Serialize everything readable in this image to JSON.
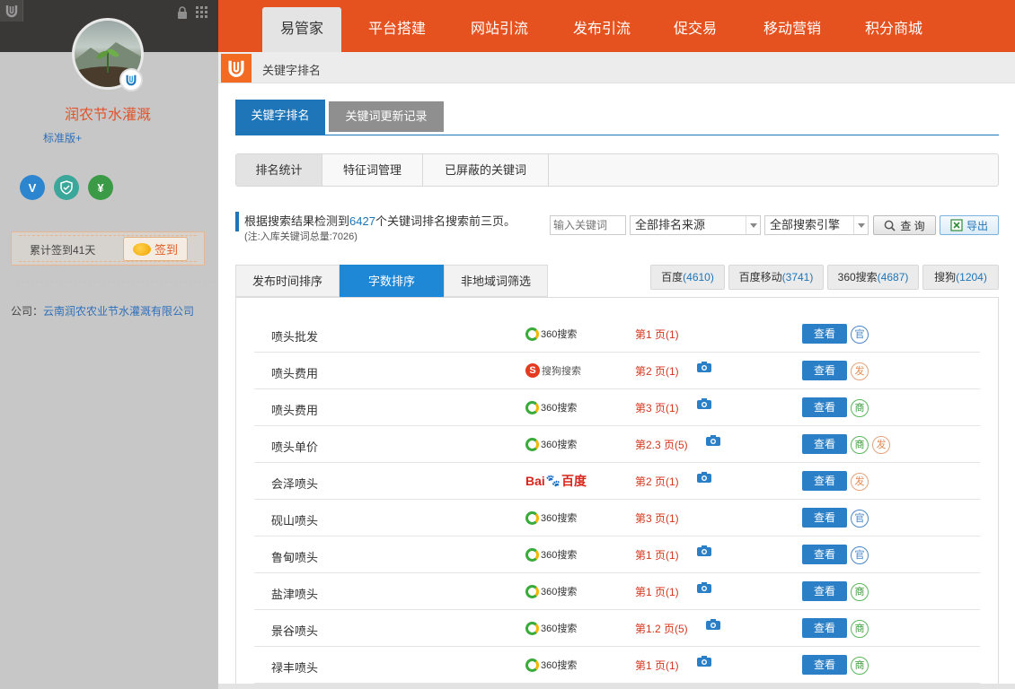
{
  "sidebar": {
    "company_short": "润农节水灌溉",
    "edition": "标准版+",
    "signin_text": "累计签到41天",
    "signin_button": "签到",
    "company_label": "公司：",
    "company_full": "云南润农农业节水灌溉有限公司",
    "badges": [
      "V",
      "✓",
      "¥"
    ]
  },
  "topnav": {
    "tabs": [
      "易管家",
      "平台搭建",
      "网站引流",
      "发布引流",
      "促交易",
      "移动营销",
      "积分商城"
    ],
    "active": 0
  },
  "breadcrumb": {
    "title": "关键字排名"
  },
  "main_tabs": [
    "关键字排名",
    "关键词更新记录"
  ],
  "sub_tabs": [
    "排名统计",
    "特征词管理",
    "已屏蔽的关键词"
  ],
  "info": {
    "prefix": "根据搜索结果检测到",
    "count": "6427",
    "suffix": "个关键词排名搜索前三页。",
    "note": "(注:入库关键词总量:7026)"
  },
  "filters": {
    "keyword_placeholder": "输入关键词",
    "source_select": "全部排名来源",
    "engine_select": "全部搜索引擎",
    "query_button": "查 询",
    "export_button": "导出"
  },
  "sort_tabs": [
    "发布时间排序",
    "字数排序",
    "非地域词筛选"
  ],
  "engines": [
    {
      "name": "百度",
      "count": "(4610)"
    },
    {
      "name": "百度移动",
      "count": "(3741)"
    },
    {
      "name": "360搜索",
      "count": "(4687)"
    },
    {
      "name": "搜狗",
      "count": "(1204)"
    }
  ],
  "engine_labels": {
    "e360": "360搜索",
    "sogou": "搜狗搜索",
    "baidu_a": "Bai",
    "baidu_b": "百度",
    "sogou_s": "S"
  },
  "view_label": "查看",
  "rows": [
    {
      "keyword": "喷头批发",
      "engine": "360",
      "rank": "第1 页(1)",
      "camera": false,
      "tags": [
        "官"
      ]
    },
    {
      "keyword": "喷头费用",
      "engine": "sogou",
      "rank": "第2 页(1)",
      "camera": true,
      "tags": [
        "发"
      ]
    },
    {
      "keyword": "喷头费用",
      "engine": "360",
      "rank": "第3 页(1)",
      "camera": true,
      "tags": [
        "商"
      ]
    },
    {
      "keyword": "喷头单价",
      "engine": "360",
      "rank": "第2.3 页(5)",
      "camera": true,
      "tags": [
        "商",
        "发"
      ]
    },
    {
      "keyword": "会泽喷头",
      "engine": "baidu",
      "rank": "第2 页(1)",
      "camera": true,
      "tags": [
        "发"
      ]
    },
    {
      "keyword": "砚山喷头",
      "engine": "360",
      "rank": "第3 页(1)",
      "camera": false,
      "tags": [
        "官"
      ]
    },
    {
      "keyword": "鲁甸喷头",
      "engine": "360",
      "rank": "第1 页(1)",
      "camera": true,
      "tags": [
        "官"
      ]
    },
    {
      "keyword": "盐津喷头",
      "engine": "360",
      "rank": "第1 页(1)",
      "camera": true,
      "tags": [
        "商"
      ]
    },
    {
      "keyword": "景谷喷头",
      "engine": "360",
      "rank": "第1.2 页(5)",
      "camera": true,
      "tags": [
        "商"
      ]
    },
    {
      "keyword": "禄丰喷头",
      "engine": "360",
      "rank": "第1 页(1)",
      "camera": true,
      "tags": [
        "商"
      ]
    }
  ],
  "colors": {
    "brand": "#e5521f",
    "accent": "#1e75b8",
    "rank": "#d4351c"
  }
}
